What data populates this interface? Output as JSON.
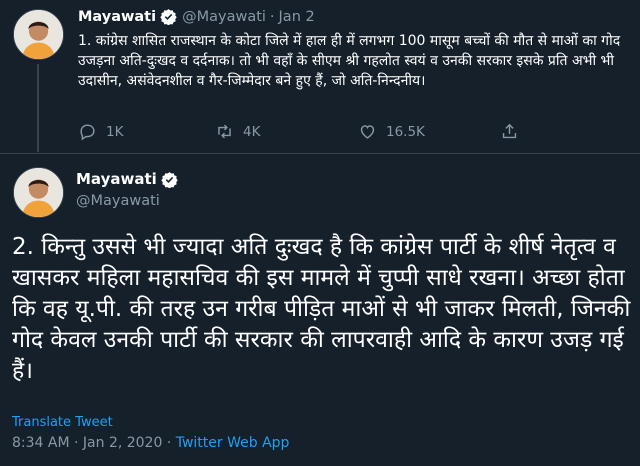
{
  "tweet1": {
    "name": "Mayawati",
    "handle": "@Mayawati",
    "separator": "·",
    "date": "Jan 2",
    "text": "1. कांग्रेस शासित राजस्थान के कोटा जिले में हाल ही में लगभग 100 मासूम बच्चों की मौत से माओं का गोद उजड़ना अति-दुःखद व दर्दनाक। तो भी वहाँ के सीएम श्री गहलोत स्वयं व उनकी सरकार इसके प्रति अभी भी उदासीन, असंवेदनशील व गैर-जिम्मेदार बने हुए हैं, जो अति-निन्दनीय।",
    "reply_count": "1K",
    "retweet_count": "4K",
    "like_count": "16.5K",
    "icons": {
      "reply": "reply-icon",
      "retweet": "retweet-icon",
      "like": "like-icon",
      "share": "share-icon",
      "verified": "verified-badge-icon"
    }
  },
  "tweet2": {
    "name": "Mayawati",
    "handle": "@Mayawati",
    "text": "2. किन्तु उससे भी ज्यादा अति दुःखद है कि कांग्रेस पार्टी के शीर्ष नेतृत्व व खासकर महिला महासचिव की इस मामले में चुप्पी साधे रखना। अच्छा होता कि वह यू.पी. की तरह उन गरीब पीड़ित माओं से भी जाकर मिलती, जिनकी गोद केवल उनकी पार्टी की सरकार की लापरवाही आदि के कारण उजड़ गई हैं।",
    "translate_label": "Translate Tweet",
    "time": "8:34 AM",
    "meta_separator": "·",
    "full_date": "Jan 2, 2020",
    "source": "Twitter Web App"
  },
  "colors": {
    "background": "#15202b",
    "border": "#38444d",
    "secondary_text": "#8899a6",
    "accent": "#1da1f2"
  }
}
